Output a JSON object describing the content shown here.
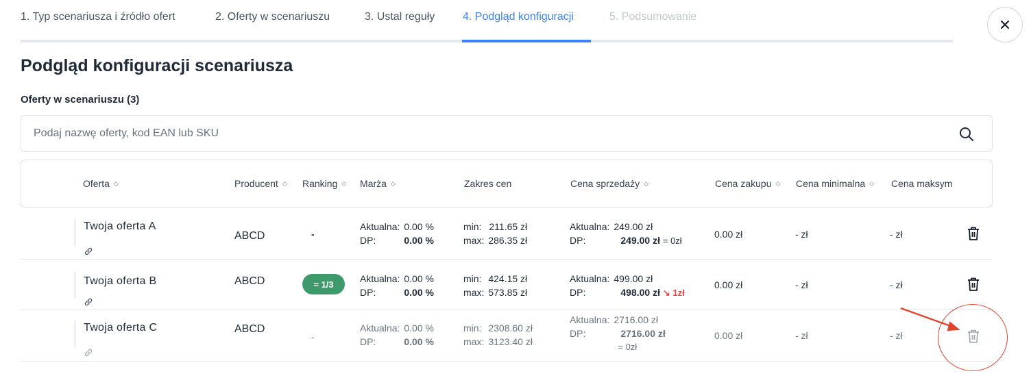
{
  "steps": [
    {
      "label": "1. Typ scenariusza i źródło ofert",
      "state": "done"
    },
    {
      "label": "2. Oferty w scenariuszu",
      "state": "done"
    },
    {
      "label": "3. Ustal reguły",
      "state": "done"
    },
    {
      "label": "4. Podgląd konfiguracji",
      "state": "active"
    },
    {
      "label": "5. Podsumowanie",
      "state": "disabled"
    }
  ],
  "close_label": "×",
  "page_title": "Podgląd konfiguracji scenariusza",
  "section_title": "Oferty w scenariuszu (3)",
  "search": {
    "placeholder": "Podaj nazwę oferty, kod EAN lub SKU",
    "value": ""
  },
  "columns": {
    "offer": "Oferta",
    "producer": "Producent",
    "ranking": "Ranking",
    "margin": "Marża",
    "price_range": "Zakres cen",
    "sale_price": "Cena sprzedaży",
    "purchase_price": "Cena zakupu",
    "min_price": "Cena minimalna",
    "max_price": "Cena maksym"
  },
  "labels": {
    "current": "Aktualna:",
    "dp": "DP:",
    "min": "min:",
    "max": "max:"
  },
  "rows": [
    {
      "name": "Twoja oferta A",
      "producer": "ABCD",
      "ranking": "-",
      "margin_current": "0.00 %",
      "margin_dp": "0.00 %",
      "range_min": "211.65 zł",
      "range_max": "286.35 zł",
      "sale_current": "249.00 zł",
      "sale_dp": "249.00 zł",
      "sale_change": "= 0zł",
      "purchase": "0.00 zł",
      "min_price": "- zł",
      "max_price": "- zł"
    },
    {
      "name": "Twoja oferta B",
      "producer": "ABCD",
      "ranking": "= 1/3",
      "margin_current": "0.00 %",
      "margin_dp": "0.00 %",
      "range_min": "424.15 zł",
      "range_max": "573.85 zł",
      "sale_current": "499.00 zł",
      "sale_dp": "498.00 zł",
      "sale_change": "↘ 1zł",
      "purchase": "0.00 zł",
      "min_price": "- zł",
      "max_price": "- zł"
    },
    {
      "name": "Twoja oferta C",
      "producer": "ABCD",
      "ranking": "-",
      "margin_current": "0.00 %",
      "margin_dp": "0.00 %",
      "range_min": "2308.60 zł",
      "range_max": "3123.40 zł",
      "sale_current": "2716.00 zł",
      "sale_dp": "2716.00 zł",
      "sale_change": "= 0zł",
      "purchase": "0.00 zł",
      "min_price": "- zł",
      "max_price": "- zł"
    }
  ],
  "colors": {
    "accent": "#3b82f6",
    "badge": "#3e9a6a",
    "decrease": "#ef4444",
    "annotation": "#e0442f"
  },
  "icons": {
    "search": "search-icon",
    "link": "link-icon",
    "delete": "trash-icon",
    "close": "close-icon"
  }
}
